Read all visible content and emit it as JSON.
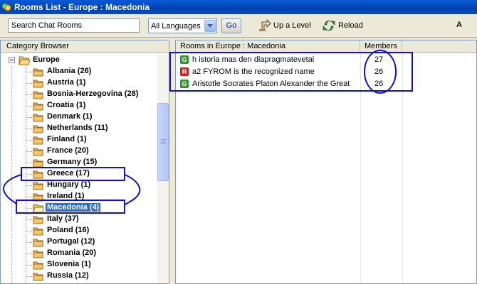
{
  "window": {
    "title": "Rooms List - Europe : Macedonia"
  },
  "toolbar": {
    "search_value": "Search Chat Rooms",
    "language_selected": "All Languages",
    "go_label": "Go",
    "uplevel_label": "Up a Level",
    "reload_label": "Reload",
    "trailing_letter": "A"
  },
  "left_pane": {
    "header": "Category Browser",
    "root": "Europe",
    "items": [
      {
        "label": "Albania (26)"
      },
      {
        "label": "Austria (1)"
      },
      {
        "label": "Bosnia-Herzegovina (28)"
      },
      {
        "label": "Croatia (1)"
      },
      {
        "label": "Denmark (1)"
      },
      {
        "label": "Netherlands (11)"
      },
      {
        "label": "Finland (1)"
      },
      {
        "label": "France (20)"
      },
      {
        "label": "Germany (15)"
      },
      {
        "label": "Greece (17)"
      },
      {
        "label": "Hungary (1)"
      },
      {
        "label": "Ireland (1)"
      },
      {
        "label": "Macedonia (4)",
        "selected": true
      },
      {
        "label": "Italy (37)"
      },
      {
        "label": "Poland (16)"
      },
      {
        "label": "Portugal (12)"
      },
      {
        "label": "Romania (20)"
      },
      {
        "label": "Slovenia (1)"
      },
      {
        "label": "Russia (12)"
      }
    ]
  },
  "right_pane": {
    "col_room": "Rooms in Europe : Macedonia",
    "col_members": "Members",
    "rooms": [
      {
        "badge": "G",
        "badge_color": "#2e9a2e",
        "name": "h istoria mas den diapragmatevetai",
        "members": "27"
      },
      {
        "badge": "R",
        "badge_color": "#c8241c",
        "name": "a2 FYROM is the recognized name",
        "members": "26"
      },
      {
        "badge": "G",
        "badge_color": "#2e9a2e",
        "name": "Aristotle Socrates Platon Alexander the Great",
        "members": "26"
      }
    ]
  },
  "colors": {
    "annotation": "#1010d8",
    "selection": "#316ac5",
    "folder": "#e8b04a"
  }
}
